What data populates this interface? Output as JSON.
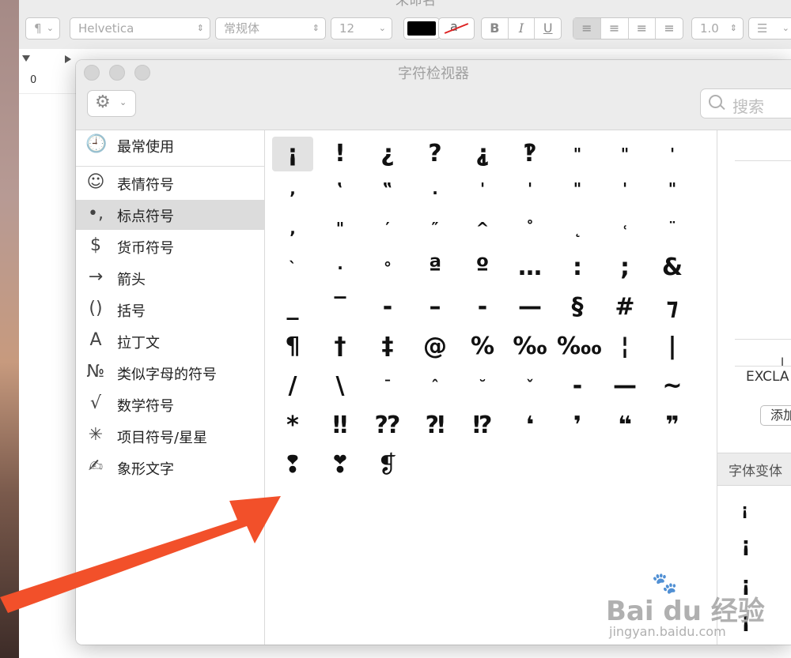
{
  "editor": {
    "title": "未命名",
    "toolbar": {
      "para_style": "¶",
      "font_family": "Helvetica",
      "font_style": "常规体",
      "font_size": "12",
      "bold": "B",
      "italic": "I",
      "underline": "U",
      "line_spacing": "1.0",
      "list_icon": "list-icon",
      "text_color": "#000000",
      "highlight_glyph": "a"
    },
    "ruler": {
      "zero_label": "0"
    }
  },
  "viewer": {
    "title": "字符检视器",
    "search_placeholder": "搜索",
    "categories": [
      {
        "icon": "clock-icon",
        "glyph": "🕘",
        "label": "最常使用"
      },
      {
        "icon": "smiley-icon",
        "glyph": "☺",
        "label": "表情符号"
      },
      {
        "icon": "punctuation-icon",
        "glyph": "•,",
        "label": "标点符号"
      },
      {
        "icon": "dollar-icon",
        "glyph": "$",
        "label": "货币符号"
      },
      {
        "icon": "arrow-icon",
        "glyph": "→",
        "label": "箭头"
      },
      {
        "icon": "parentheses-icon",
        "glyph": "()",
        "label": "括号"
      },
      {
        "icon": "latin-a-icon",
        "glyph": "A",
        "label": "拉丁文"
      },
      {
        "icon": "numero-icon",
        "glyph": "№",
        "label": "类似字母的符号"
      },
      {
        "icon": "sqrt-icon",
        "glyph": "√",
        "label": "数学符号"
      },
      {
        "icon": "asterisk-icon",
        "glyph": "✳",
        "label": "项目符号/星星"
      },
      {
        "icon": "pictograph-icon",
        "glyph": "✍",
        "label": "象形文字"
      }
    ],
    "selected_category": 2,
    "characters": [
      [
        "¡",
        "!",
        "¿",
        "?",
        "⸘",
        "‽",
        "\"",
        "\"",
        "'"
      ],
      [
        ",",
        "‛",
        "‟",
        ".",
        "'",
        "'",
        "\"",
        "'",
        "\""
      ],
      [
        ",",
        "\"",
        "′",
        "″",
        "^",
        "˚",
        "˛",
        "˓",
        "¨"
      ],
      [
        "`",
        "·",
        "°",
        "ª",
        "º",
        "…",
        ":",
        ";",
        "&"
      ],
      [
        "_",
        "‾",
        "‐",
        "–",
        "‑",
        "—",
        "§",
        "#",
        "⁊"
      ],
      [
        "¶",
        "†",
        "‡",
        "@",
        "%",
        "‰",
        "‱",
        "¦",
        "|"
      ],
      [
        "/",
        "\\",
        "ˉ",
        "ˆ",
        "˘",
        "ˇ",
        "‐",
        "—",
        "~"
      ],
      [
        "*",
        "‼",
        "⁇",
        "⁈",
        "⁉",
        "❛",
        "❜",
        "❝",
        "❞"
      ],
      [
        "❢",
        "❣",
        "❡"
      ]
    ],
    "selected_character": "¡",
    "info": {
      "char_name_partial": "EXCLA",
      "add_button": "添加",
      "variants_header": "字体变体",
      "variants": [
        "¡",
        "¡",
        "¡",
        "¡"
      ]
    }
  },
  "overlay": {
    "arrow_color": "#f2502a",
    "watermark_brand": "Bai du 经验",
    "watermark_site": "jingyan.baidu.com"
  }
}
